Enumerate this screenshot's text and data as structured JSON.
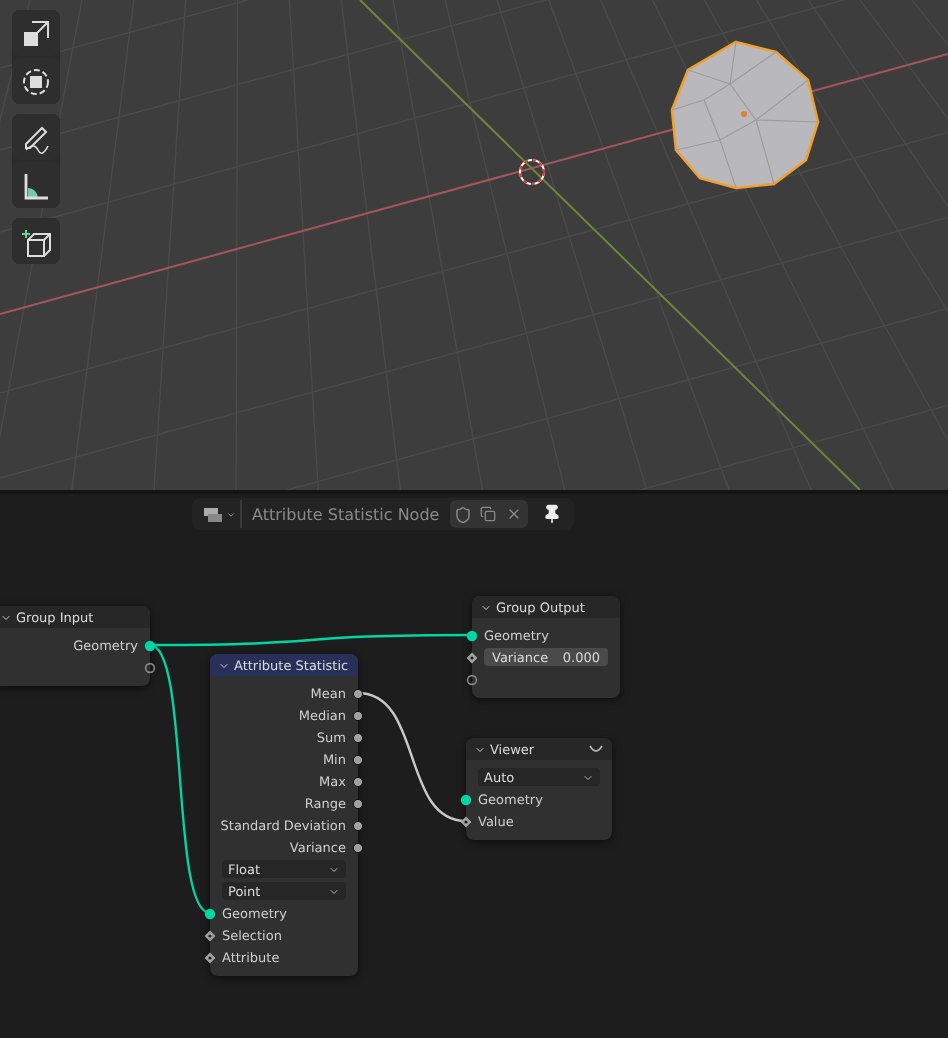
{
  "node_editor": {
    "title": "Attribute Statistic Node",
    "nodes": [
      {
        "kind": "group_input",
        "title": "Group Input",
        "color": "#272727",
        "rows": [
          {
            "kind": "output",
            "label": "Geometry",
            "socket": {
              "kind": "geometry"
            }
          },
          {
            "kind": "blank_output",
            "socket": {
              "kind": "empty"
            }
          }
        ]
      },
      {
        "kind": "group_output",
        "title": "Group Output",
        "color": "#272727",
        "rows": [
          {
            "kind": "input",
            "label": "Geometry",
            "socket": {
              "kind": "geometry"
            }
          },
          {
            "kind": "field",
            "label": "Variance",
            "value": "0.000",
            "socket": {
              "kind": "field"
            }
          },
          {
            "kind": "blank_input",
            "socket": {
              "kind": "empty"
            }
          }
        ]
      },
      {
        "kind": "converter",
        "title": "Attribute Statistic",
        "color": "#28305a",
        "rows": [
          {
            "kind": "output",
            "label": "Mean",
            "socket": {
              "kind": "value"
            }
          },
          {
            "kind": "output",
            "label": "Median",
            "socket": {
              "kind": "value"
            }
          },
          {
            "kind": "output",
            "label": "Sum",
            "socket": {
              "kind": "value"
            }
          },
          {
            "kind": "output",
            "label": "Min",
            "socket": {
              "kind": "value"
            }
          },
          {
            "kind": "output",
            "label": "Max",
            "socket": {
              "kind": "value"
            }
          },
          {
            "kind": "output",
            "label": "Range",
            "socket": {
              "kind": "value"
            }
          },
          {
            "kind": "output",
            "label": "Standard Deviation",
            "socket": {
              "kind": "value"
            }
          },
          {
            "kind": "output",
            "label": "Variance",
            "socket": {
              "kind": "value"
            }
          },
          {
            "kind": "dropdown",
            "label": "Float"
          },
          {
            "kind": "dropdown",
            "label": "Point"
          },
          {
            "kind": "input",
            "label": "Geometry",
            "socket": {
              "kind": "geometry"
            }
          },
          {
            "kind": "input",
            "label": "Selection",
            "socket": {
              "kind": "field"
            }
          },
          {
            "kind": "input",
            "label": "Attribute",
            "socket": {
              "kind": "field"
            }
          }
        ]
      },
      {
        "kind": "viewer",
        "title": "Viewer",
        "color": "#272727",
        "rows": [
          {
            "kind": "dropdown",
            "label": "Auto"
          },
          {
            "kind": "input",
            "label": "Geometry",
            "socket": {
              "kind": "geometry"
            }
          },
          {
            "kind": "input",
            "label": "Value",
            "socket": {
              "kind": "field"
            }
          }
        ]
      }
    ]
  }
}
